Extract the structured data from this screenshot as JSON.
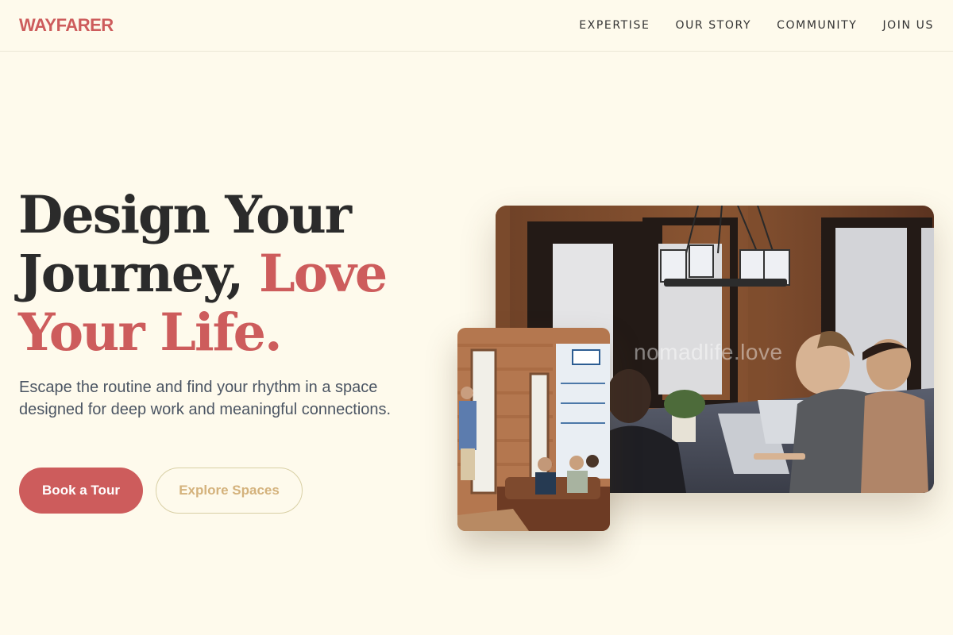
{
  "brand": {
    "name": "WAYFARER",
    "color": "#cd5c5c"
  },
  "nav": {
    "items": [
      {
        "label": "EXPERTISE"
      },
      {
        "label": "OUR STORY"
      },
      {
        "label": "COMMUNITY"
      },
      {
        "label": "JOIN US"
      }
    ]
  },
  "hero": {
    "title_line1": "Design Your",
    "title_line2_plain": "Journey, ",
    "title_line2_accent": "Love",
    "title_line3_accent": "Your Life.",
    "subtitle": "Escape the routine and find your rhythm in a space designed for deep work and meaningful connections.",
    "primary_cta": "Book a Tour",
    "secondary_cta": "Explore Spaces"
  },
  "images": {
    "main_alt": "People working around a table in a coworking space",
    "small_alt": "Presenter speaking to people seated on a sofa",
    "watermark": "nomadlife.love"
  },
  "colors": {
    "background": "#fefaec",
    "accent": "#cd5c5c",
    "secondary_button_text": "#d4b27c"
  }
}
